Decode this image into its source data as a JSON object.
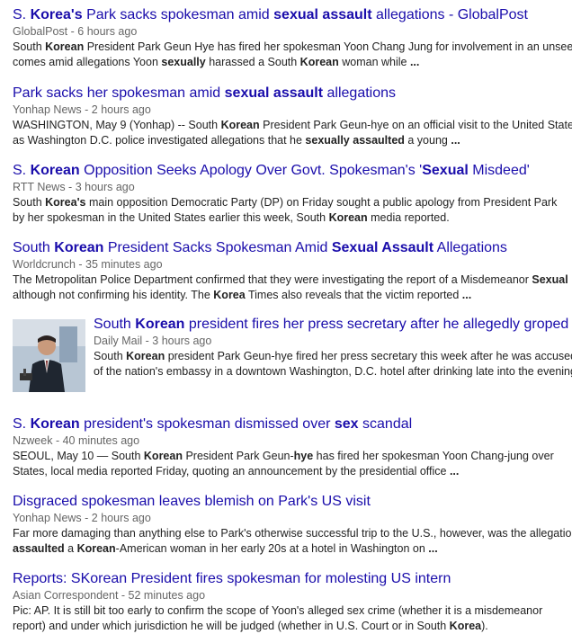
{
  "results": [
    {
      "title": [
        [
          "S. ",
          0
        ],
        [
          "Korea's",
          1
        ],
        [
          " Park sacks spokesman amid ",
          0
        ],
        [
          "sexual assault",
          1
        ],
        [
          " allegations - GlobalPost",
          0
        ]
      ],
      "source": "GlobalPost",
      "time": "6 hours ago",
      "snippet": [
        [
          [
            "South ",
            0
          ],
          [
            "Korean",
            1
          ],
          [
            " President Park Geun Hye has fired her spokesman Yoon Chang Jung for involvement in an unseemly",
            0
          ]
        ],
        [
          [
            "comes amid allegations Yoon ",
            0
          ],
          [
            "sexually",
            1
          ],
          [
            " harassed a South ",
            0
          ],
          [
            "Korean",
            1
          ],
          [
            " woman while ",
            0
          ],
          [
            "...",
            1
          ]
        ]
      ]
    },
    {
      "title": [
        [
          "Park sacks her spokesman amid ",
          0
        ],
        [
          "sexual assault",
          1
        ],
        [
          " allegations",
          0
        ]
      ],
      "source": "Yonhap News",
      "time": "2 hours ago",
      "snippet": [
        [
          [
            "WASHINGTON, May 9 (Yonhap) -- South ",
            0
          ],
          [
            "Korean",
            1
          ],
          [
            " President Park Geun-hye on an official visit to the United States",
            0
          ]
        ],
        [
          [
            "as Washington D.C. police investigated allegations that he ",
            0
          ],
          [
            "sexually assaulted",
            1
          ],
          [
            " a young ",
            0
          ],
          [
            "...",
            1
          ]
        ]
      ]
    },
    {
      "title": [
        [
          "S. ",
          0
        ],
        [
          "Korean",
          1
        ],
        [
          " Opposition Seeks Apology Over Govt. Spokesman's '",
          0
        ],
        [
          "Sexual",
          1
        ],
        [
          " Misdeed'",
          0
        ]
      ],
      "source": "RTT News",
      "time": "3 hours ago",
      "snippet": [
        [
          [
            "South ",
            0
          ],
          [
            "Korea's",
            1
          ],
          [
            " main opposition Democratic Party (DP) on Friday sought a public apology from President Park",
            0
          ]
        ],
        [
          [
            "by her spokesman in the United States earlier this week, South ",
            0
          ],
          [
            "Korean",
            1
          ],
          [
            " media reported.",
            0
          ]
        ]
      ]
    },
    {
      "title": [
        [
          "South ",
          0
        ],
        [
          "Korean",
          1
        ],
        [
          " President Sacks Spokesman Amid ",
          0
        ],
        [
          "Sexual Assault",
          1
        ],
        [
          " Allegations",
          0
        ]
      ],
      "source": "Worldcrunch",
      "time": "35 minutes ago",
      "snippet": [
        [
          [
            "The Metropolitan Police Department confirmed that they were investigating the report of a Misdemeanor ",
            0
          ],
          [
            "Sexual",
            1
          ]
        ],
        [
          [
            "although not confirming his identity. The ",
            0
          ],
          [
            "Korea",
            1
          ],
          [
            " Times also reveals that the victim reported ",
            0
          ],
          [
            "...",
            1
          ]
        ]
      ]
    },
    {
      "title": [
        [
          "South ",
          0
        ],
        [
          "Korean",
          1
        ],
        [
          " president fires her press secretary after he allegedly groped",
          0
        ]
      ],
      "source": "Daily Mail",
      "time": "3 hours ago",
      "snippet": [
        [
          [
            "South ",
            0
          ],
          [
            "Korean",
            1
          ],
          [
            " president Park Geun-hye fired her press secretary this week after he was accused",
            0
          ]
        ],
        [
          [
            "of the nation's embassy in a downtown Washington, D.C. hotel after drinking late into the evening",
            0
          ]
        ]
      ]
    },
    {
      "title": [
        [
          "S. ",
          0
        ],
        [
          "Korean",
          1
        ],
        [
          " president's spokesman dismissed over ",
          0
        ],
        [
          "sex",
          1
        ],
        [
          " scandal",
          0
        ]
      ],
      "source": "Nzweek",
      "time": "40 minutes ago",
      "snippet": [
        [
          [
            "SEOUL, May 10 — South ",
            0
          ],
          [
            "Korean",
            1
          ],
          [
            " President Park Geun-",
            0
          ],
          [
            "hye",
            1
          ],
          [
            " has fired her spokesman Yoon Chang-jung over",
            0
          ]
        ],
        [
          [
            "States, local media reported Friday, quoting an announcement by the presidential office ",
            0
          ],
          [
            "...",
            1
          ]
        ]
      ]
    },
    {
      "title": [
        [
          "Disgraced spokesman leaves blemish on Park's US visit",
          0
        ]
      ],
      "source": "Yonhap News",
      "time": "2 hours ago",
      "snippet": [
        [
          [
            "Far more damaging than anything else to Park's otherwise successful trip to the U.S., however, was the allegation",
            0
          ]
        ],
        [
          [
            "assaulted",
            1
          ],
          [
            " a ",
            0
          ],
          [
            "Korean",
            1
          ],
          [
            "-American woman in her early 20s at a hotel in Washington on ",
            0
          ],
          [
            "...",
            1
          ]
        ]
      ]
    },
    {
      "title": [
        [
          "Reports: SKorean President fires spokesman for molesting US intern",
          0
        ]
      ],
      "source": "Asian Correspondent",
      "time": "52 minutes ago",
      "snippet": [
        [
          [
            "Pic: AP. It is still bit too early to confirm the scope of Yoon's alleged sex crime (whether it is a misdemeanor",
            0
          ]
        ],
        [
          [
            "report) and under which jurisdiction he will be judged (whether in U.S. Court or in South ",
            0
          ],
          [
            "Korea",
            1
          ],
          [
            ").",
            0
          ]
        ]
      ]
    }
  ]
}
